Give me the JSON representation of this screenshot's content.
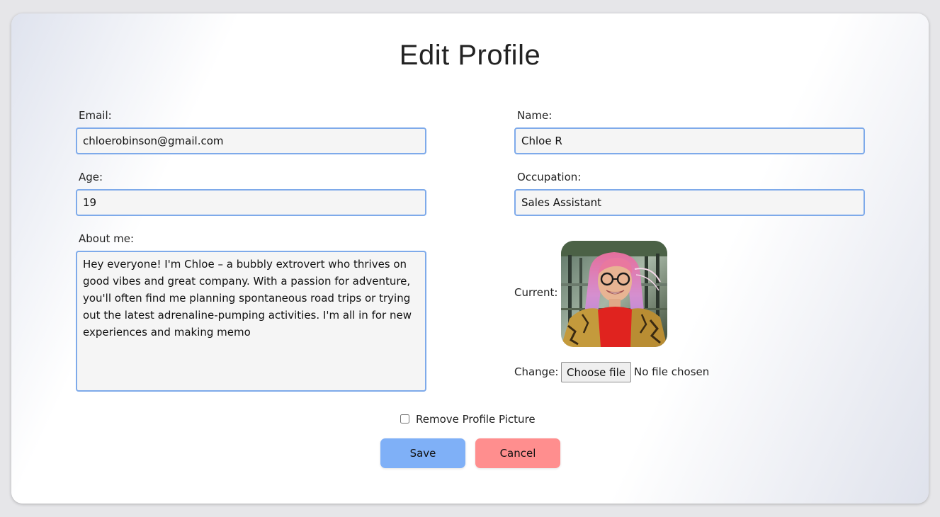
{
  "page": {
    "title": "Edit Profile"
  },
  "form": {
    "email": {
      "label": "Email:",
      "value": "chloerobinson@gmail.com"
    },
    "name": {
      "label": "Name:",
      "value": "Chloe R"
    },
    "age": {
      "label": "Age:",
      "value": "19"
    },
    "occupation": {
      "label": "Occupation:",
      "value": "Sales Assistant"
    },
    "about": {
      "label": "About me:",
      "value": "Hey everyone! I'm Chloe – a bubbly extrovert who thrives on good vibes and great company. With a passion for adventure, you'll often find me planning spontaneous road trips or trying out the latest adrenaline-pumping activities. I'm all in for new experiences and making memo"
    },
    "picture": {
      "current_label": "Current:",
      "change_label": "Change:",
      "choose_button": "Choose file",
      "file_status": "No file chosen",
      "remove_label": "Remove Profile Picture",
      "remove_checked": false
    }
  },
  "actions": {
    "save": "Save",
    "cancel": "Cancel"
  },
  "colors": {
    "field_border": "#7eaaea",
    "save_button": "#7fb0f7",
    "cancel_button": "#ff8e8e"
  },
  "icons": {
    "avatar": "profile-photo"
  }
}
